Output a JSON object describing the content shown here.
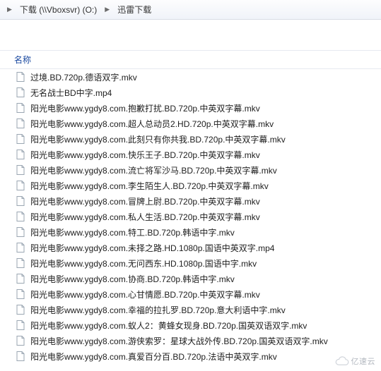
{
  "breadcrumb": {
    "items": [
      "下载 (\\\\Vboxsvr) (O:)",
      "迅雷下载"
    ],
    "separator_glyph": "▶"
  },
  "columns": {
    "name": "名称"
  },
  "files": [
    {
      "name": "过境.BD.720p.德语双字.mkv"
    },
    {
      "name": "无名战士BD中字.mp4"
    },
    {
      "name": "阳光电影www.ygdy8.com.抱歉打扰.BD.720p.中英双字幕.mkv"
    },
    {
      "name": "阳光电影www.ygdy8.com.超人总动员2.HD.720p.中英双字幕.mkv"
    },
    {
      "name": "阳光电影www.ygdy8.com.此刻只有你共我.BD.720p.中英双字幕.mkv"
    },
    {
      "name": "阳光电影www.ygdy8.com.快乐王子.BD.720p.中英双字幕.mkv"
    },
    {
      "name": "阳光电影www.ygdy8.com.流亡将军沙马.BD.720p.中英双字幕.mkv"
    },
    {
      "name": "阳光电影www.ygdy8.com.李生陌生人.BD.720p.中英双字幕.mkv"
    },
    {
      "name": "阳光电影www.ygdy8.com.冒牌上尉.BD.720p.中英双字幕.mkv"
    },
    {
      "name": "阳光电影www.ygdy8.com.私人生活.BD.720p.中英双字幕.mkv"
    },
    {
      "name": "阳光电影www.ygdy8.com.特工.BD.720p.韩语中字.mkv"
    },
    {
      "name": "阳光电影www.ygdy8.com.未择之路.HD.1080p.国语中英双字.mp4"
    },
    {
      "name": "阳光电影www.ygdy8.com.无问西东.HD.1080p.国语中字.mkv"
    },
    {
      "name": "阳光电影www.ygdy8.com.协商.BD.720p.韩语中字.mkv"
    },
    {
      "name": "阳光电影www.ygdy8.com.心甘情愿.BD.720p.中英双字幕.mkv"
    },
    {
      "name": "阳光电影www.ygdy8.com.幸福的拉扎罗.BD.720p.意大利语中字.mkv"
    },
    {
      "name": "阳光电影www.ygdy8.com.蚁人2：黄蜂女现身.BD.720p.国英双语双字.mkv"
    },
    {
      "name": "阳光电影www.ygdy8.com.游侠索罗：星球大战外传.BD.720p.国英双语双字.mkv"
    },
    {
      "name": "阳光电影www.ygdy8.com.真爱百分百.BD.720p.法语中英双字.mkv"
    }
  ],
  "watermark": {
    "text": "亿速云"
  }
}
